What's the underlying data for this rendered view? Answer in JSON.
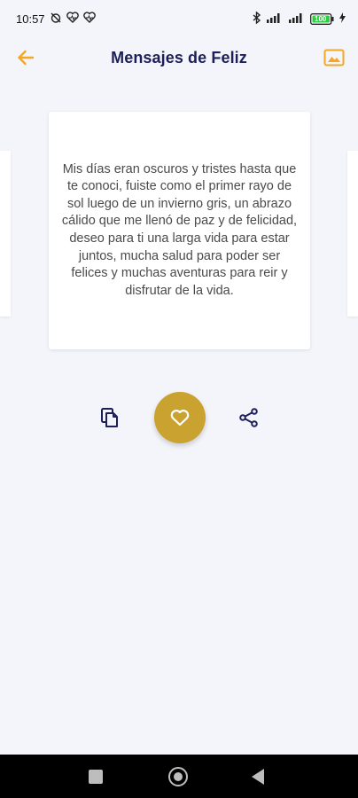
{
  "status_bar": {
    "time": "10:57",
    "battery_level": "100"
  },
  "app_bar": {
    "title": "Mensajes de Feliz"
  },
  "message": {
    "text": "Mis días eran oscuros y tristes hasta que te conoci, fuiste como el primer rayo de sol luego de un invierno gris, un abrazo cálido que me llenó de paz y de felicidad, deseo para ti una larga vida para estar juntos, mucha salud para poder ser felices y muchas aventuras para reir y disfrutar de la vida."
  },
  "actions": {
    "copy_icon": "copy-icon",
    "favorite_icon": "heart-icon",
    "share_icon": "share-icon"
  },
  "colors": {
    "accent_orange": "#f5a623",
    "title_navy": "#1c1f5a",
    "favorite_gold": "#c9a230",
    "background": "#f4f5fa"
  }
}
